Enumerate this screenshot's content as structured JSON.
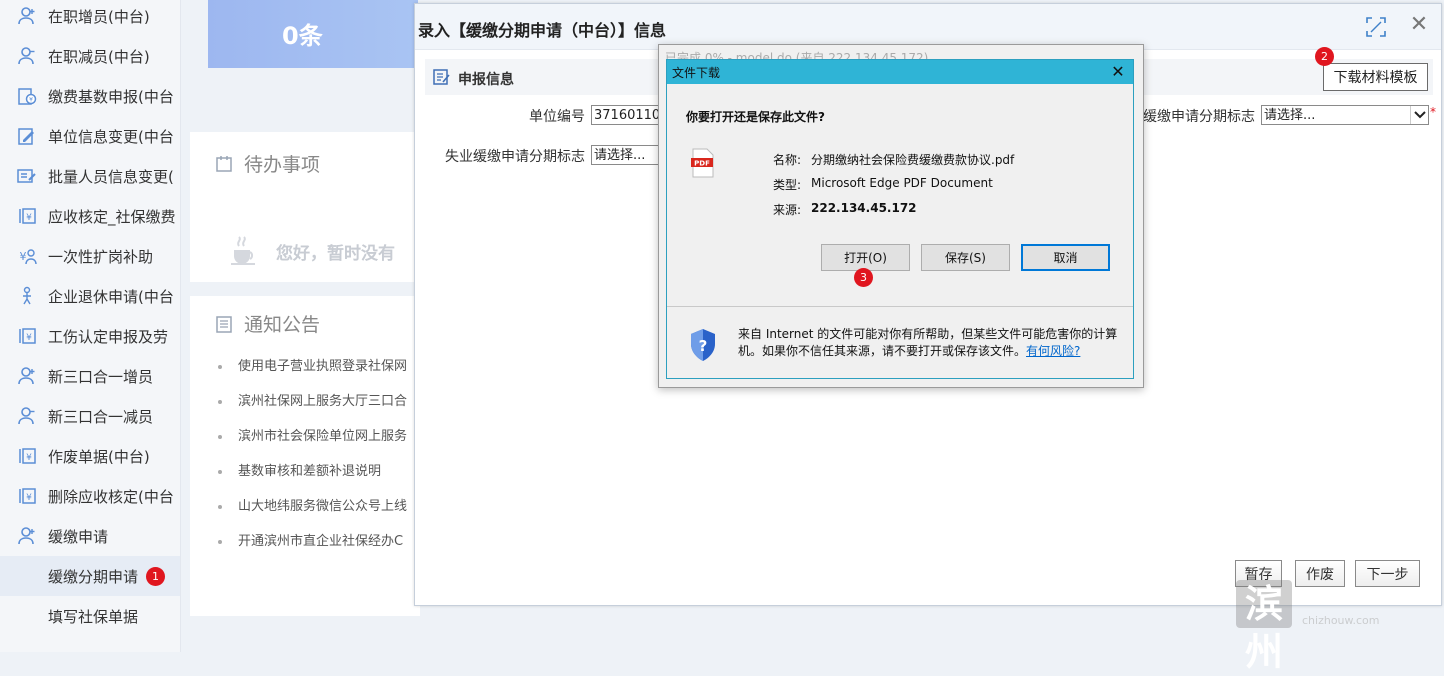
{
  "sidebar": {
    "items": [
      {
        "label": "在职增员(中台)",
        "icon": "user-add-icon"
      },
      {
        "label": "在职减员(中台)",
        "icon": "user-remove-icon"
      },
      {
        "label": "缴费基数申报(中台",
        "icon": "money-report-icon"
      },
      {
        "label": "单位信息变更(中台",
        "icon": "edit-doc-icon"
      },
      {
        "label": "批量人员信息变更(",
        "icon": "batch-edit-icon"
      },
      {
        "label": "应收核定_社保缴费",
        "icon": "yuan-doc-icon"
      },
      {
        "label": "一次性扩岗补助",
        "icon": "subsidy-icon"
      },
      {
        "label": "企业退休申请(中台",
        "icon": "retire-icon"
      },
      {
        "label": "工伤认定申报及劳",
        "icon": "injury-doc-icon"
      },
      {
        "label": "新三口合一增员",
        "icon": "user-add-icon"
      },
      {
        "label": "新三口合一减员",
        "icon": "user-remove-icon"
      },
      {
        "label": "作废单据(中台)",
        "icon": "yuan-doc-icon"
      },
      {
        "label": "删除应收核定(中台",
        "icon": "yuan-doc-icon"
      },
      {
        "label": "缓缴申请",
        "icon": "user-add-icon"
      }
    ],
    "sub_items": [
      {
        "label": "缓缴分期申请",
        "badge": "1",
        "active": true
      },
      {
        "label": "填写社保单据"
      }
    ]
  },
  "dashboard": {
    "count": "0条",
    "todo_title": "待办事项",
    "todo_empty": "您好，暂时没有",
    "notice_title": "通知公告",
    "notices": [
      "使用电子营业执照登录社保网",
      "滨州社保网上服务大厅三口合",
      "滨州市社会保险单位网上服务",
      "基数审核和差额补退说明",
      "山大地纬服务微信公众号上线",
      "开通滨州市直企业社保经办C"
    ]
  },
  "dialog": {
    "title": "录入【缓缴分期申请（中台）】信息",
    "section": "申报信息",
    "download_button": "下载材料模板",
    "download_badge": "2",
    "fields": {
      "unit_code_label": "单位编号",
      "unit_code_value": "3716011053",
      "delay_flag_label": "缓缴申请分期标志",
      "delay_flag_value": "请选择...",
      "unemp_flag_label": "失业缓缴申请分期标志",
      "unemp_flag_value": "请选择..."
    },
    "footer_buttons": {
      "save": "暂存",
      "void": "作废",
      "next": "下一步"
    }
  },
  "ghost_window": {
    "title": "已完成 0% - model.do (来自 222.134.45.172)"
  },
  "file_download": {
    "title": "文件下载",
    "question": "你要打开还是保存此文件?",
    "name_label": "名称:",
    "name_value": "分期缴纳社会保险费缓缴费款协议.pdf",
    "type_label": "类型:",
    "type_value": "Microsoft Edge PDF Document",
    "source_label": "来源:",
    "source_value": "222.134.45.172",
    "open_button": "打开(O)",
    "save_button": "保存(S)",
    "cancel_button": "取消",
    "open_badge": "3",
    "warning_text": "来自 Internet 的文件可能对你有所帮助，但某些文件可能危害你的计算机。如果你不信任其来源，请不要打开或保存该文件。",
    "risk_link": "有何风险?"
  },
  "watermark": {
    "text": "滨州",
    "site": "chizhouw.com"
  },
  "colors": {
    "badge_red": "#e0161f",
    "dialog_title_bar": "#2fb4d6",
    "accent_blue": "#5b8ed6"
  }
}
